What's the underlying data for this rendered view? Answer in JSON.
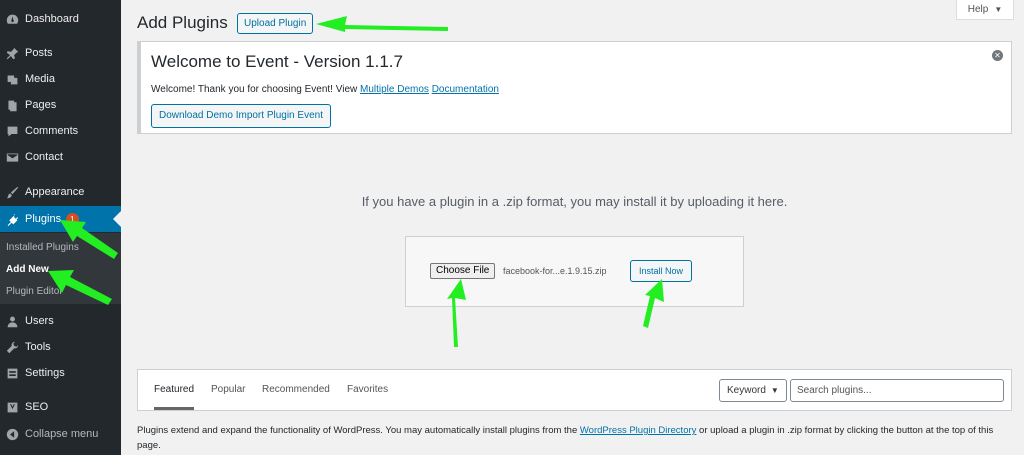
{
  "sidebar": {
    "items": [
      {
        "label": "Dashboard",
        "icon": "dashboard-icon"
      },
      {
        "label": "Posts",
        "icon": "pin-icon"
      },
      {
        "label": "Media",
        "icon": "media-icon"
      },
      {
        "label": "Pages",
        "icon": "pages-icon"
      },
      {
        "label": "Comments",
        "icon": "comment-icon"
      },
      {
        "label": "Contact",
        "icon": "mail-icon"
      },
      {
        "label": "Appearance",
        "icon": "brush-icon"
      },
      {
        "label": "Plugins",
        "icon": "plugin-icon",
        "badge": "1"
      },
      {
        "label": "Users",
        "icon": "user-icon"
      },
      {
        "label": "Tools",
        "icon": "wrench-icon"
      },
      {
        "label": "Settings",
        "icon": "settings-icon"
      },
      {
        "label": "SEO",
        "icon": "seo-icon"
      },
      {
        "label": "Collapse menu",
        "icon": "collapse-icon"
      }
    ],
    "submenu": [
      "Installed Plugins",
      "Add New",
      "Plugin Editor"
    ]
  },
  "header": {
    "title": "Add Plugins",
    "upload_label": "Upload Plugin",
    "help_label": "Help"
  },
  "notice": {
    "title": "Welcome to Event - Version 1.1.7",
    "text_prefix": "Welcome! Thank you for choosing Event! View ",
    "link1": "Multiple Demos",
    "link2": "Documentation",
    "button": "Download Demo Import Plugin Event",
    "dismiss": "✕"
  },
  "upload": {
    "message": "If you have a plugin in a .zip format, you may install it by uploading it here.",
    "choose_label": "Choose File",
    "file_name": "facebook-for...e.1.9.15.zip",
    "install_label": "Install Now"
  },
  "filter": {
    "tabs": [
      "Featured",
      "Popular",
      "Recommended",
      "Favorites"
    ],
    "keyword": "Keyword",
    "search_placeholder": "Search plugins..."
  },
  "footer": {
    "prefix": "Plugins extend and expand the functionality of WordPress. You may automatically install plugins from the ",
    "link": "WordPress Plugin Directory",
    "suffix": " or upload a plugin in .zip format by clicking the button at the top of this page."
  },
  "colors": {
    "sidebar": "#23282d",
    "accent": "#0073aa",
    "annotation_arrow": "#22ee22"
  }
}
